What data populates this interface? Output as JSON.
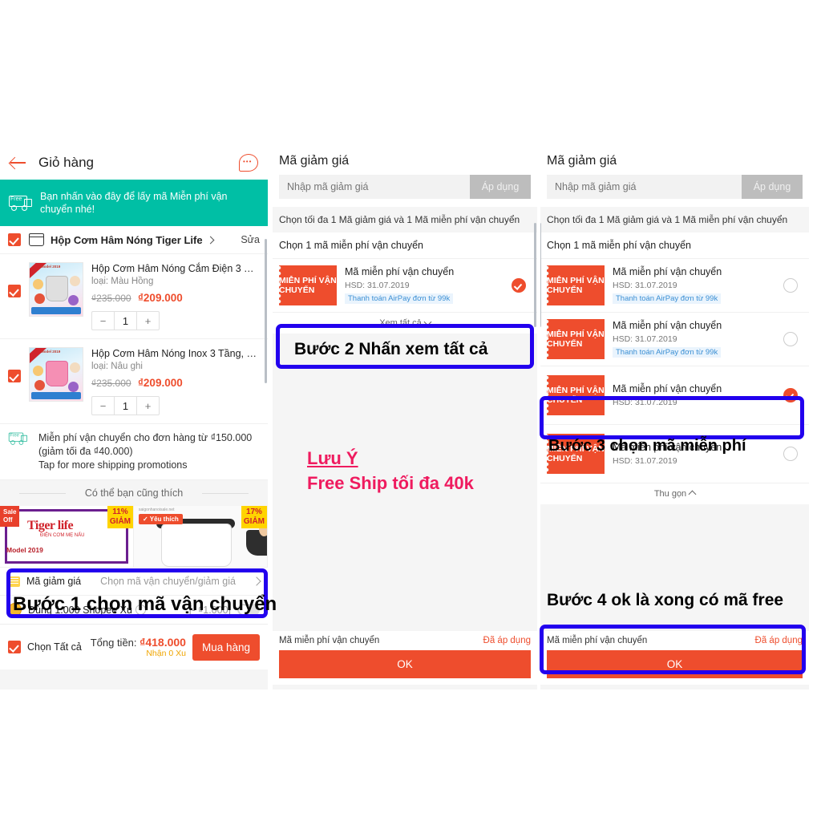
{
  "cart": {
    "header": {
      "title": "Giỏ hàng",
      "back_icon": "back-arrow-icon",
      "chat_icon": "chat-bubble-icon"
    },
    "promo_banner": {
      "text": "Bạn nhấn vào đây để lấy mã Miễn phí vận chuyển nhé!",
      "icon": "free-shipping-truck-icon",
      "color": "#00bfa5"
    },
    "shop": {
      "name": "Hộp Cơm Hâm Nóng Tiger Life",
      "edit_label": "Sửa",
      "icon": "shop-icon"
    },
    "items": [
      {
        "title": "Hộp Cơm Hâm Nóng Cắm Điện 3 Tần...",
        "variant": "loại: Màu Hồng",
        "price_old": "₫235.000",
        "price_new": "₫209.000",
        "qty": "1",
        "minus": "−",
        "plus": "+"
      },
      {
        "title": "Hộp Cơm Hâm Nóng Inox 3 Tầng, Hộ...",
        "variant": "loại: Nâu ghi",
        "price_old": "₫235.000",
        "price_new": "₫209.000",
        "qty": "1",
        "minus": "−",
        "plus": "+"
      }
    ],
    "shipping_promo": {
      "line1": "Miễn phí vận chuyển cho đơn hàng từ ₫150.000",
      "line2": "(giảm tối đa ₫40.000)",
      "line3": "Tap for more shipping promotions"
    },
    "also_like_title": "Có thể bạn cũng thích",
    "reco": [
      {
        "sale_badge": "Sale\nOff",
        "brand": "Tiger life",
        "brand_sub": "ĐIỆN CƠM MẸ NẤU",
        "model": "Model 2019",
        "discount": "11%\nGIẢM"
      },
      {
        "fav_badge": "✓ Yêu thích",
        "watermark": "saigonhanoisale.net",
        "discount": "17%\nGIẢM"
      }
    ],
    "voucher_row": {
      "label": "Mã giảm giá",
      "value": "Chọn mã vận chuyển/giảm giá",
      "icon": "voucher-ticket-icon"
    },
    "xu_row": {
      "label": "Dùng 1.000 Shopee Xu",
      "value": "[- ₫1.000]",
      "icon": "coin-icon",
      "help_icon": "question-icon"
    },
    "checkout": {
      "select_all": "Chọn Tất cả",
      "total_label": "Tổng tiền:",
      "total_amount": "₫418.000",
      "xu_note": "Nhận 0 Xu",
      "buy_label": "Mua hàng"
    }
  },
  "voucher_mid": {
    "title": "Mã giảm giá",
    "input_placeholder": "Nhập mã giảm giá",
    "apply_label": "Áp dụng",
    "note": "Chọn tối đa 1 Mã giảm giá và 1 Mã miễn phí vận chuyển",
    "subheader": "Chọn 1 mã miễn phí vận chuyển",
    "vouchers": [
      {
        "tag": "MIỄN PHÍ VẬN CHUYỂN",
        "name": "Mã miễn phí vận chuyển",
        "expiry": "HSD: 31.07.2019",
        "airpay": "Thanh toán AirPay đơn từ 99k",
        "selected": true
      }
    ],
    "see_all_label": "Xem tất cả",
    "footer": {
      "label": "Mã miễn phí vận chuyển",
      "applied": "Đã áp dụng",
      "ok_label": "OK"
    }
  },
  "voucher_right": {
    "title": "Mã giảm giá",
    "input_placeholder": "Nhập mã giảm giá",
    "apply_label": "Áp dụng",
    "note": "Chọn tối đa 1 Mã giảm giá và 1 Mã miễn phí vận chuyển",
    "subheader": "Chọn 1 mã miễn phí vận chuyển",
    "vouchers": [
      {
        "tag": "MIỄN PHÍ VẬN CHUYỂN",
        "name": "Mã miễn phí vận chuyển",
        "expiry": "HSD: 31.07.2019",
        "airpay": "Thanh toán AirPay đơn từ 99k",
        "selected": false
      },
      {
        "tag": "MIỄN PHÍ VẬN CHUYỂN",
        "name": "Mã miễn phí vận chuyển",
        "expiry": "HSD: 31.07.2019",
        "airpay": "Thanh toán AirPay đơn từ 99k",
        "selected": false
      },
      {
        "tag": "MIỄN PHÍ VẬN CHUYỂN",
        "name": "Mã miễn phí vận chuyển",
        "expiry": "HSD: 31.07.2019",
        "airpay": "",
        "selected": true
      },
      {
        "tag": "MIỄN PHÍ VẬN CHUYỂN",
        "name": "Mã miễn phí vận chuyển",
        "expiry": "HSD: 31.07.2019",
        "airpay": "",
        "selected": false
      }
    ],
    "collapse_label": "Thu gọn",
    "footer": {
      "label": "Mã miễn phí vận chuyển",
      "applied": "Đã áp dụng",
      "ok_label": "OK"
    }
  },
  "annotations": {
    "step1": "Bước 1 chọn mã vận chuyển",
    "step2": "Bước 2 Nhấn xem tất cả",
    "step3": "Bước 3 chọn mã miễn phí",
    "step4": "Bước 4 ok là xong có mã free",
    "note_title": "Lưu Ý",
    "note_body": "Free Ship tối đa 40k",
    "highlight_color": "#2200ee",
    "note_color": "#ef1b5f"
  }
}
